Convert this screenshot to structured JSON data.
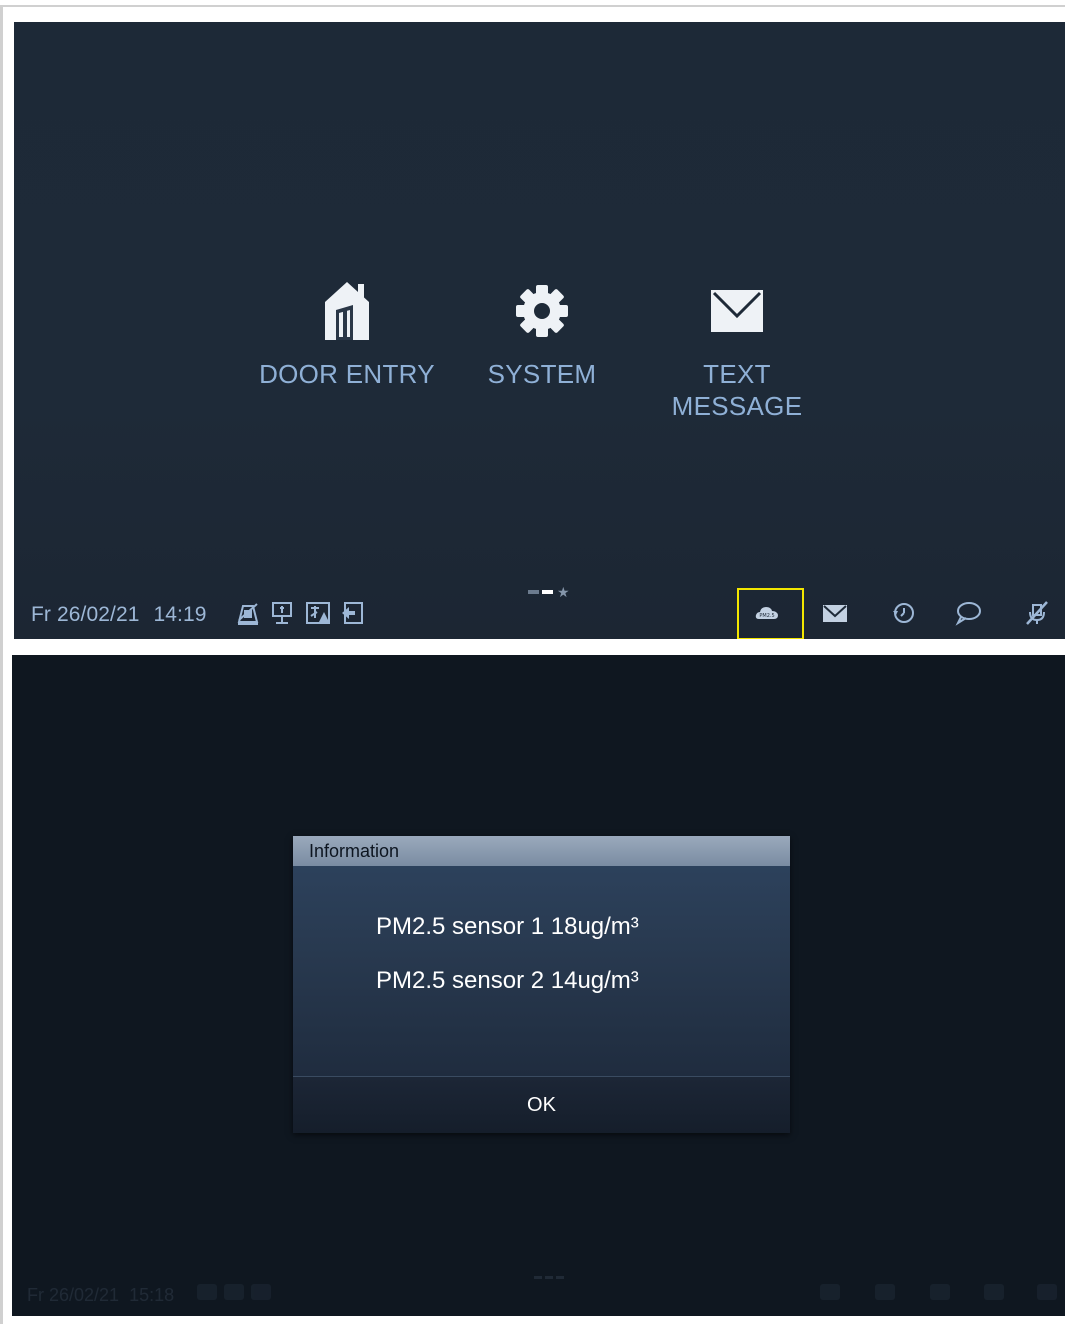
{
  "home_screen": {
    "tiles": [
      {
        "label": "DOOR ENTRY",
        "icon": "house-door-icon"
      },
      {
        "label": "SYSTEM",
        "icon": "gear-icon"
      },
      {
        "label": "TEXT\nMESSAGE",
        "icon": "envelope-icon"
      }
    ],
    "page_indicator": {
      "pages": 2,
      "active_index": 1,
      "has_favorites_star": true
    },
    "status_bar": {
      "date": "Fr 26/02/21",
      "time": "14:19",
      "left_icons": [
        "do-not-disturb-icon",
        "monitor-icon",
        "alarm-icon",
        "return-home-icon"
      ],
      "right_icons": [
        "pm25-cloud-icon",
        "mail-icon",
        "history-icon",
        "chat-icon",
        "mute-icon"
      ],
      "highlighted_icon": "pm25-cloud-icon"
    },
    "colors": {
      "label": "#8fb0d6",
      "background": "#1e2a38",
      "highlight": "#f2e600"
    }
  },
  "info_dialog": {
    "title": "Information",
    "lines": [
      "PM2.5 sensor 1 18ug/m³",
      "PM2.5 sensor 2 14ug/m³"
    ],
    "ok_label": "OK"
  },
  "background_status": {
    "date": "Fr 26/02/21",
    "time": "15:18"
  }
}
